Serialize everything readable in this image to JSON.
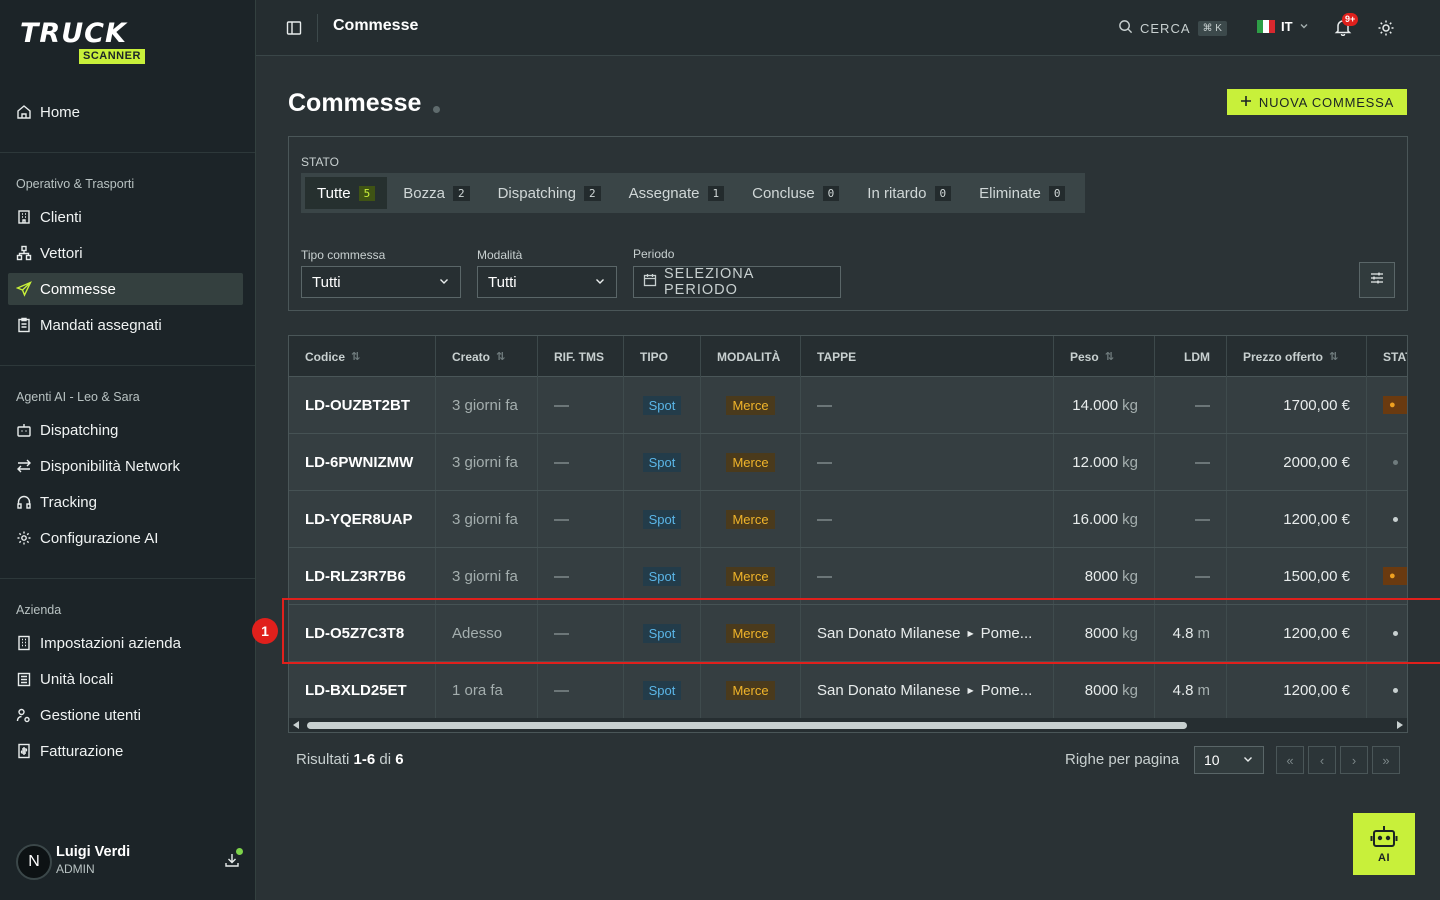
{
  "brand": {
    "logo_text": "TRUCK",
    "logo_sub": "SCANNER"
  },
  "sidebar": {
    "home": "Home",
    "sections": [
      {
        "title": "Operativo & Trasporti",
        "items": [
          "Clienti",
          "Vettori",
          "Commesse",
          "Mandati assegnati"
        ]
      },
      {
        "title": "Agenti AI - Leo & Sara",
        "items": [
          "Dispatching",
          "Disponibilità Network",
          "Tracking",
          "Configurazione AI"
        ]
      },
      {
        "title": "Azienda",
        "items": [
          "Impostazioni azienda",
          "Unità locali",
          "Gestione utenti",
          "Fatturazione"
        ]
      }
    ],
    "active_item": "Commesse",
    "user": {
      "initial": "N",
      "name": "Luigi Verdi",
      "role": "ADMIN"
    }
  },
  "topbar": {
    "title": "Commesse",
    "search_label": "CERCA",
    "search_shortcut": "⌘ K",
    "language": "IT",
    "notifications_badge": "9+"
  },
  "page": {
    "title": "Commesse",
    "new_button": "NUOVA COMMESSA"
  },
  "filters": {
    "stato_label": "STATO",
    "tabs": [
      {
        "label": "Tutte",
        "count": "5"
      },
      {
        "label": "Bozza",
        "count": "2"
      },
      {
        "label": "Dispatching",
        "count": "2"
      },
      {
        "label": "Assegnate",
        "count": "1"
      },
      {
        "label": "Concluse",
        "count": "0"
      },
      {
        "label": "In ritardo",
        "count": "0"
      },
      {
        "label": "Eliminate",
        "count": "0"
      }
    ],
    "tipo_label": "Tipo commessa",
    "tipo_value": "Tutti",
    "modalita_label": "Modalità",
    "modalita_value": "Tutti",
    "periodo_label": "Periodo",
    "periodo_button": "SELEZIONA PERIODO"
  },
  "table": {
    "headers": [
      "Codice",
      "Creato",
      "RIF. TMS",
      "TIPO",
      "MODALITÀ",
      "TAPPE",
      "Peso",
      "LDM",
      "Prezzo offerto",
      "STATO"
    ],
    "rows": [
      {
        "code": "LD-OUZBT2BT",
        "created": "3 giorni fa",
        "rif": "—",
        "tipo": "Spot",
        "modalita": "Merce",
        "tappe_from": "—",
        "tappe_to": "",
        "peso_num": "14.000",
        "peso_unit": "kg",
        "ldm_num": "—",
        "ldm_unit": "",
        "prezzo": "1700,00 €",
        "stato": "orange"
      },
      {
        "code": "LD-6PWNIZMW",
        "created": "3 giorni fa",
        "rif": "—",
        "tipo": "Spot",
        "modalita": "Merce",
        "tappe_from": "—",
        "tappe_to": "",
        "peso_num": "12.000",
        "peso_unit": "kg",
        "ldm_num": "—",
        "ldm_unit": "",
        "prezzo": "2000,00 €",
        "stato": "grey"
      },
      {
        "code": "LD-YQER8UAP",
        "created": "3 giorni fa",
        "rif": "—",
        "tipo": "Spot",
        "modalita": "Merce",
        "tappe_from": "—",
        "tappe_to": "",
        "peso_num": "16.000",
        "peso_unit": "kg",
        "ldm_num": "—",
        "ldm_unit": "",
        "prezzo": "1200,00 €",
        "stato": "white"
      },
      {
        "code": "LD-RLZ3R7B6",
        "created": "3 giorni fa",
        "rif": "—",
        "tipo": "Spot",
        "modalita": "Merce",
        "tappe_from": "—",
        "tappe_to": "",
        "peso_num": "8000",
        "peso_unit": "kg",
        "ldm_num": "—",
        "ldm_unit": "",
        "prezzo": "1500,00 €",
        "stato": "orange"
      },
      {
        "code": "LD-O5Z7C3T8",
        "created": "Adesso",
        "rif": "—",
        "tipo": "Spot",
        "modalita": "Merce",
        "tappe_from": "San Donato Milanese",
        "tappe_to": "Pome...",
        "peso_num": "8000",
        "peso_unit": "kg",
        "ldm_num": "4.8",
        "ldm_unit": "m",
        "prezzo": "1200,00 €",
        "stato": "white"
      },
      {
        "code": "LD-BXLD25ET",
        "created": "1 ora fa",
        "rif": "—",
        "tipo": "Spot",
        "modalita": "Merce",
        "tappe_from": "San Donato Milanese",
        "tappe_to": "Pome...",
        "peso_num": "8000",
        "peso_unit": "kg",
        "ldm_num": "4.8",
        "ldm_unit": "m",
        "prezzo": "1200,00 €",
        "stato": "white"
      }
    ],
    "highlight_badge": "1"
  },
  "pagination": {
    "results_prefix": "Risultati",
    "results_range": "1-6",
    "results_of": "di",
    "results_total": "6",
    "rows_per_page_label": "Righe per pagina",
    "rows_per_page_value": "10"
  },
  "ai_button": "AI",
  "colors": {
    "accent": "#c8f03a",
    "highlight": "#e0201c",
    "spot": "#5bb6e8",
    "merce": "#f0b42a"
  }
}
